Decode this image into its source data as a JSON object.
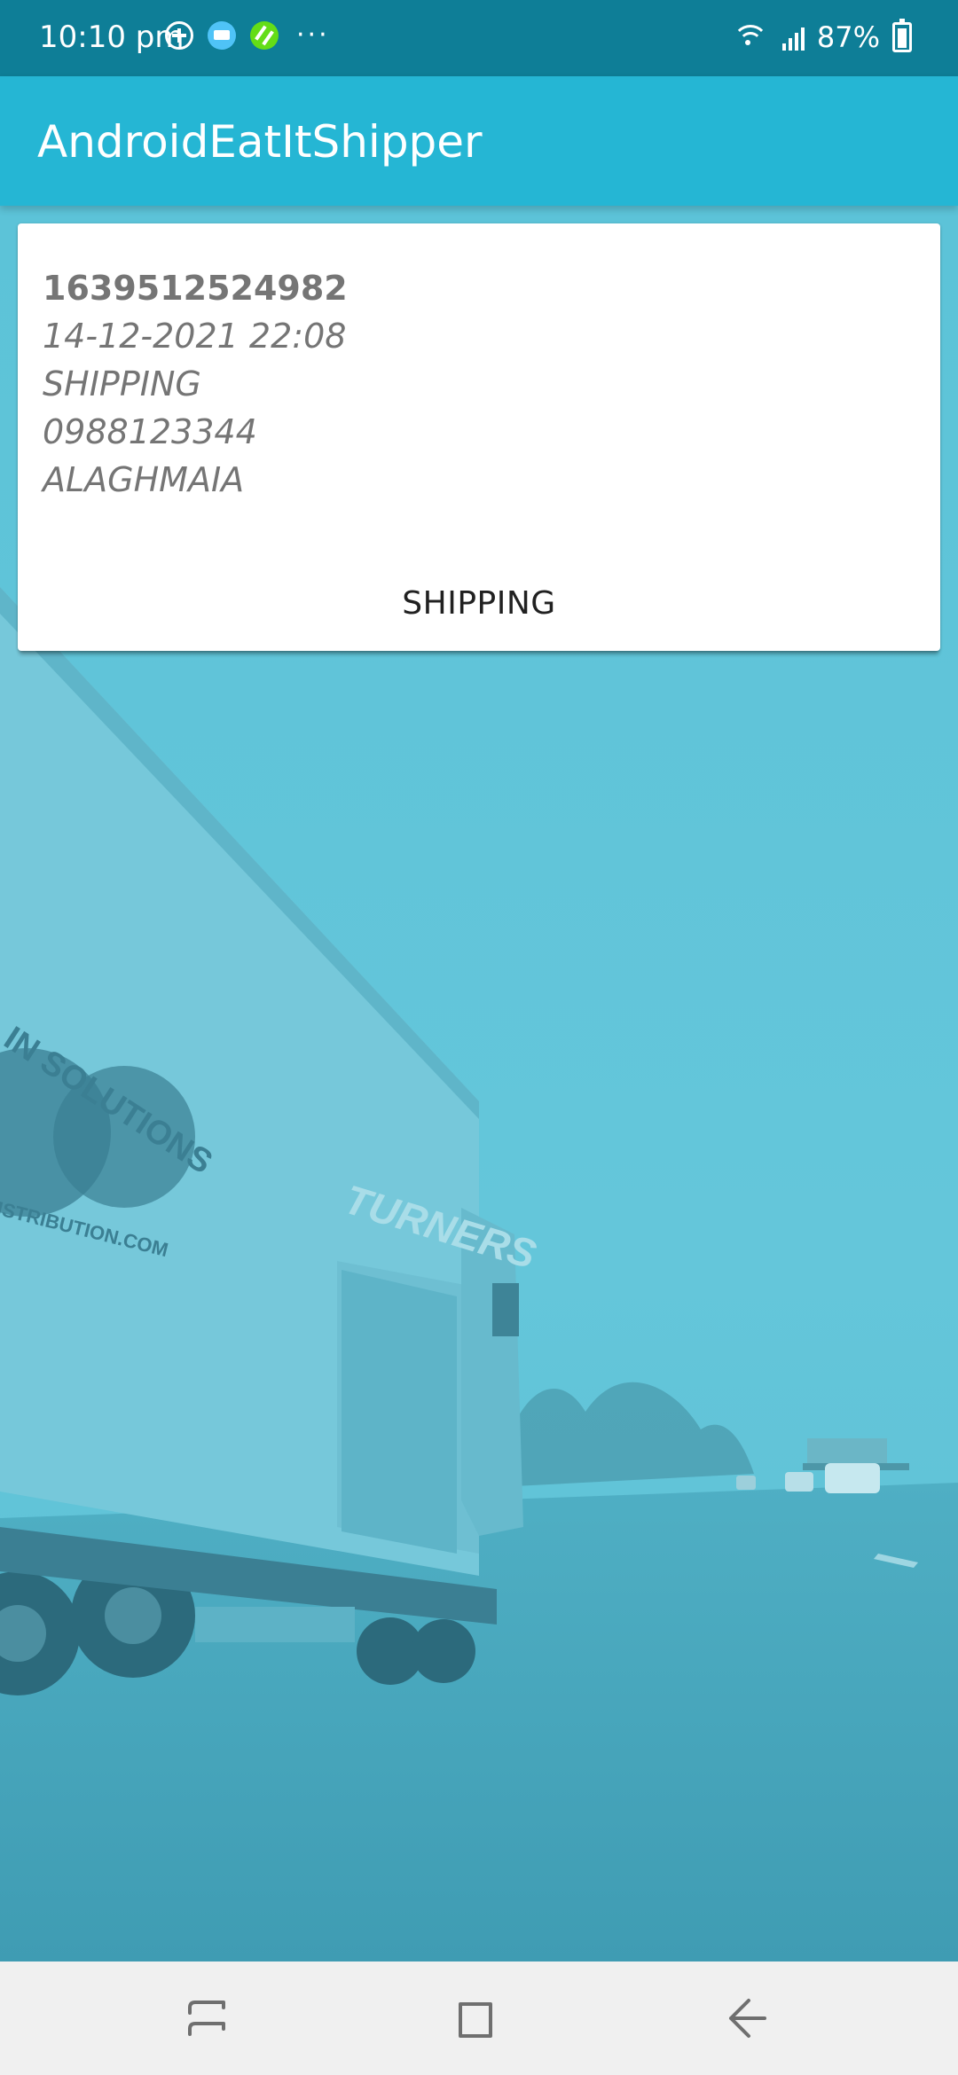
{
  "status_bar": {
    "time": "10:10 pm",
    "battery_percent": "87%",
    "icons": [
      "add-circle-icon",
      "delivery-truck-icon",
      "food-app-icon",
      "more-dots-icon",
      "wifi-icon",
      "signal-icon",
      "battery-charging-icon"
    ],
    "more": "···"
  },
  "app_bar": {
    "title": "AndroidEatItShipper",
    "color": "#25b6d4"
  },
  "order": {
    "id": "1639512524982",
    "date": "14-12-2021 22:08",
    "status": "SHIPPING",
    "phone": "0988123344",
    "address": "ALAGHMAIA",
    "action_label": "SHIPPING"
  },
  "background": {
    "truck_text_1": "IN SOLUTIONS",
    "truck_text_2": "ISTRIBUTION.COM",
    "truck_text_3": "TURNERS",
    "tint_color": "#5bbfd4"
  },
  "nav_bar": {
    "buttons": [
      "recents-icon",
      "home-icon",
      "back-icon"
    ]
  }
}
